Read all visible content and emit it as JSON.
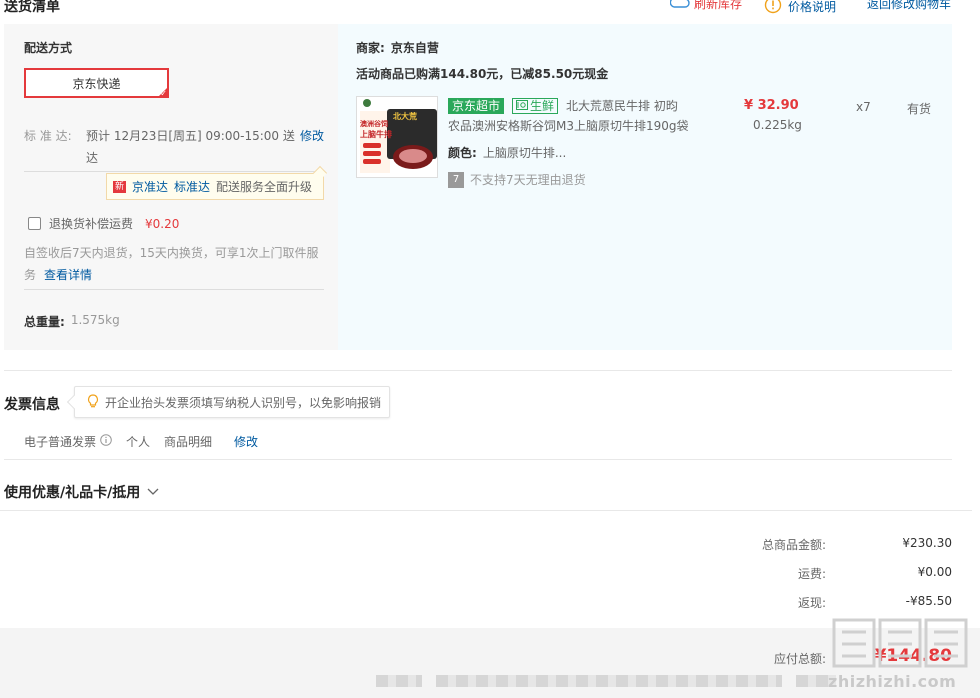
{
  "header": {
    "title": "送货清单",
    "refresh_stock": "刷新库存",
    "price_note": "价格说明",
    "back_to_cart": "返回修改购物车"
  },
  "shipping": {
    "method_label": "配送方式",
    "method_value": "京东快递",
    "eta_label": "标 准 达:",
    "eta_line1": "预计 12月23日[周五] 09:00-15:00 送",
    "eta_line2": "达",
    "modify": "修改",
    "tip_new": "新",
    "tip_jzd": "京准达",
    "tip_bzd": "标准达",
    "tip_text": "配送服务全面升级",
    "return_label": "退换货补偿运费",
    "return_price": "¥0.20",
    "policy_line1": "自签收后7天内退货，15天内换货，可享1次上门取件服",
    "policy_line2": "务",
    "policy_link": "查看详情",
    "weight_label": "总重量:",
    "weight_value": "1.575kg"
  },
  "merchant": {
    "label": "商家:",
    "name": "京东自营",
    "promo": "活动商品已购满144.80元，已减85.50元现金"
  },
  "product": {
    "badge_store": "京东超市",
    "badge_fresh": "生鲜",
    "title_line1": "北大荒蒽民牛排 初昀",
    "title_line2": "农品澳洲安格斯谷饲M3上脑原切牛排190g袋",
    "color_label": "颜色:",
    "color_value": "上脑原切牛排...",
    "no_return": "不支持7天无理由退货",
    "seven_badge": "7",
    "price": "¥ 32.90",
    "weight": "0.225kg",
    "qty": "x7",
    "stock": "有货",
    "thumb_text_top": "北大荒",
    "thumb_text_main": "上脑牛排",
    "thumb_text_side": "澳洲谷饲"
  },
  "invoice": {
    "title": "发票信息",
    "tip": "开企业抬头发票须填写纳税人识别号，以免影响报销",
    "type": "电子普通发票",
    "person": "个人",
    "detail": "商品明细",
    "modify": "修改"
  },
  "coupon": {
    "title": "使用优惠/礼品卡/抵用"
  },
  "totals": {
    "goods_label": "总商品金额:",
    "goods_value": "¥230.30",
    "ship_label": "运费:",
    "ship_value": "¥0.00",
    "rebate_label": "返现:",
    "rebate_value": "-¥85.50",
    "pay_label": "应付总额:",
    "pay_value": "¥144.80"
  },
  "watermark": {
    "site": "zhizhizhi.com"
  },
  "colors": {
    "accent_red": "#e4393c",
    "link_blue": "#005aa0",
    "green": "#2aa85a"
  }
}
